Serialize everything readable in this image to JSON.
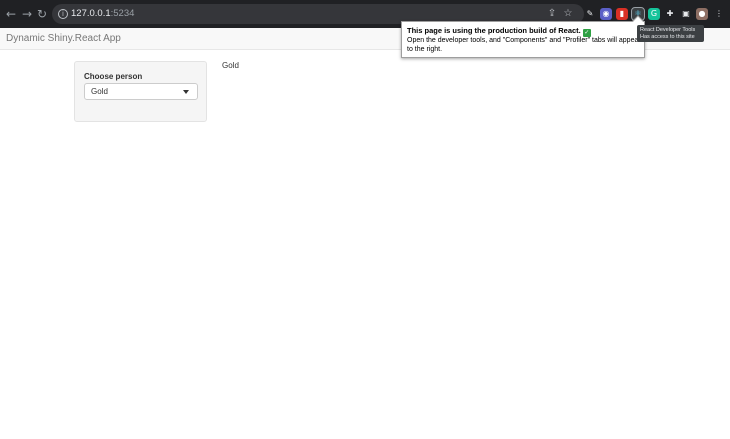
{
  "browser": {
    "url_host": "127.0.0.1",
    "url_port": ":5234",
    "back_glyph": "←",
    "forward_glyph": "→",
    "reload_glyph": "↻",
    "extensions": [
      {
        "name": "pen-extension-icon",
        "color": "#202124",
        "glyph": "✎"
      },
      {
        "name": "vpn-extension-icon",
        "color": "#5b5fc7",
        "glyph": "◉"
      },
      {
        "name": "shield-extension-icon",
        "color": "#d93025",
        "glyph": "▮"
      },
      {
        "name": "react-devtools-icon",
        "color": "#3c4043",
        "glyph": "⚛"
      },
      {
        "name": "grammarly-icon",
        "color": "#15c39a",
        "glyph": "G"
      },
      {
        "name": "puzzle-extensions-icon",
        "color": "#202124",
        "glyph": "✚"
      },
      {
        "name": "sidepanel-icon",
        "color": "#202124",
        "glyph": "▣"
      },
      {
        "name": "profile-avatar-icon",
        "color": "#8d6e63",
        "glyph": "●"
      },
      {
        "name": "menu-kebab-icon",
        "color": "#202124",
        "glyph": "⋮"
      }
    ]
  },
  "app": {
    "title": "Dynamic Shiny.React App",
    "sidebar": {
      "label": "Choose person",
      "selected": "Gold"
    },
    "output": "Gold"
  },
  "react_popup": {
    "title": "This page is using the production build of React.",
    "check_glyph": "✓",
    "body": "Open the developer tools, and \"Components\" and \"Profiler\" tabs will appear to the right."
  },
  "tooltip": {
    "line1": "React Developer Tools",
    "line2": "Has access to this site"
  }
}
